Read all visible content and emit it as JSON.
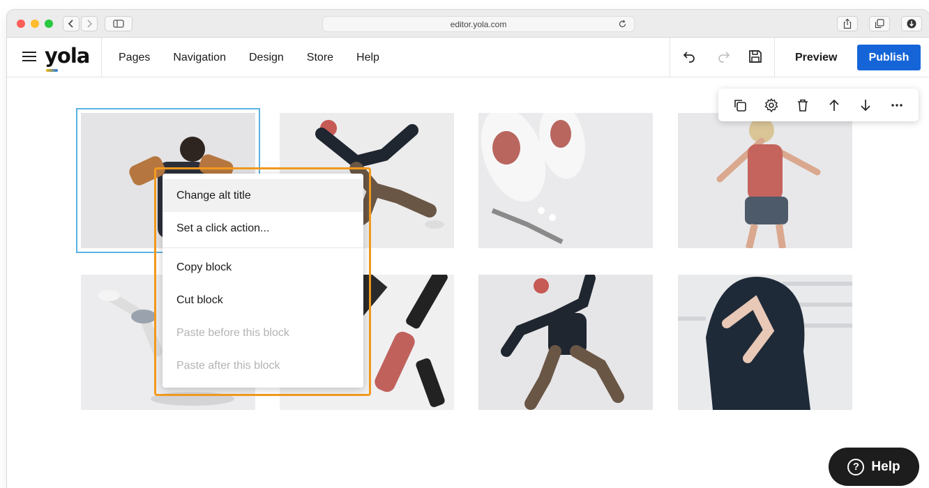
{
  "browser": {
    "url": "editor.yola.com"
  },
  "app": {
    "logo": "yola",
    "nav": [
      "Pages",
      "Navigation",
      "Design",
      "Store",
      "Help"
    ],
    "preview_label": "Preview",
    "publish_label": "Publish",
    "publish_color": "#1565d8"
  },
  "block_toolbar": {
    "icons": [
      "duplicate-icon",
      "settings-gear-icon",
      "trash-icon",
      "move-up-arrow-icon",
      "move-down-arrow-icon",
      "more-options-icon"
    ]
  },
  "gallery": {
    "image_count": 8,
    "selected_index": 0
  },
  "context_menu": {
    "items": [
      {
        "label": "Change alt title",
        "enabled": true
      },
      {
        "label": "Set a click action...",
        "enabled": true
      },
      {
        "label": "Copy block",
        "enabled": true
      },
      {
        "label": "Cut block",
        "enabled": true
      },
      {
        "label": "Paste before this block",
        "enabled": false
      },
      {
        "label": "Paste after this block",
        "enabled": false
      }
    ],
    "highlight_color": "#f39a1e"
  },
  "help_button": {
    "label": "Help",
    "glyph": "?"
  }
}
